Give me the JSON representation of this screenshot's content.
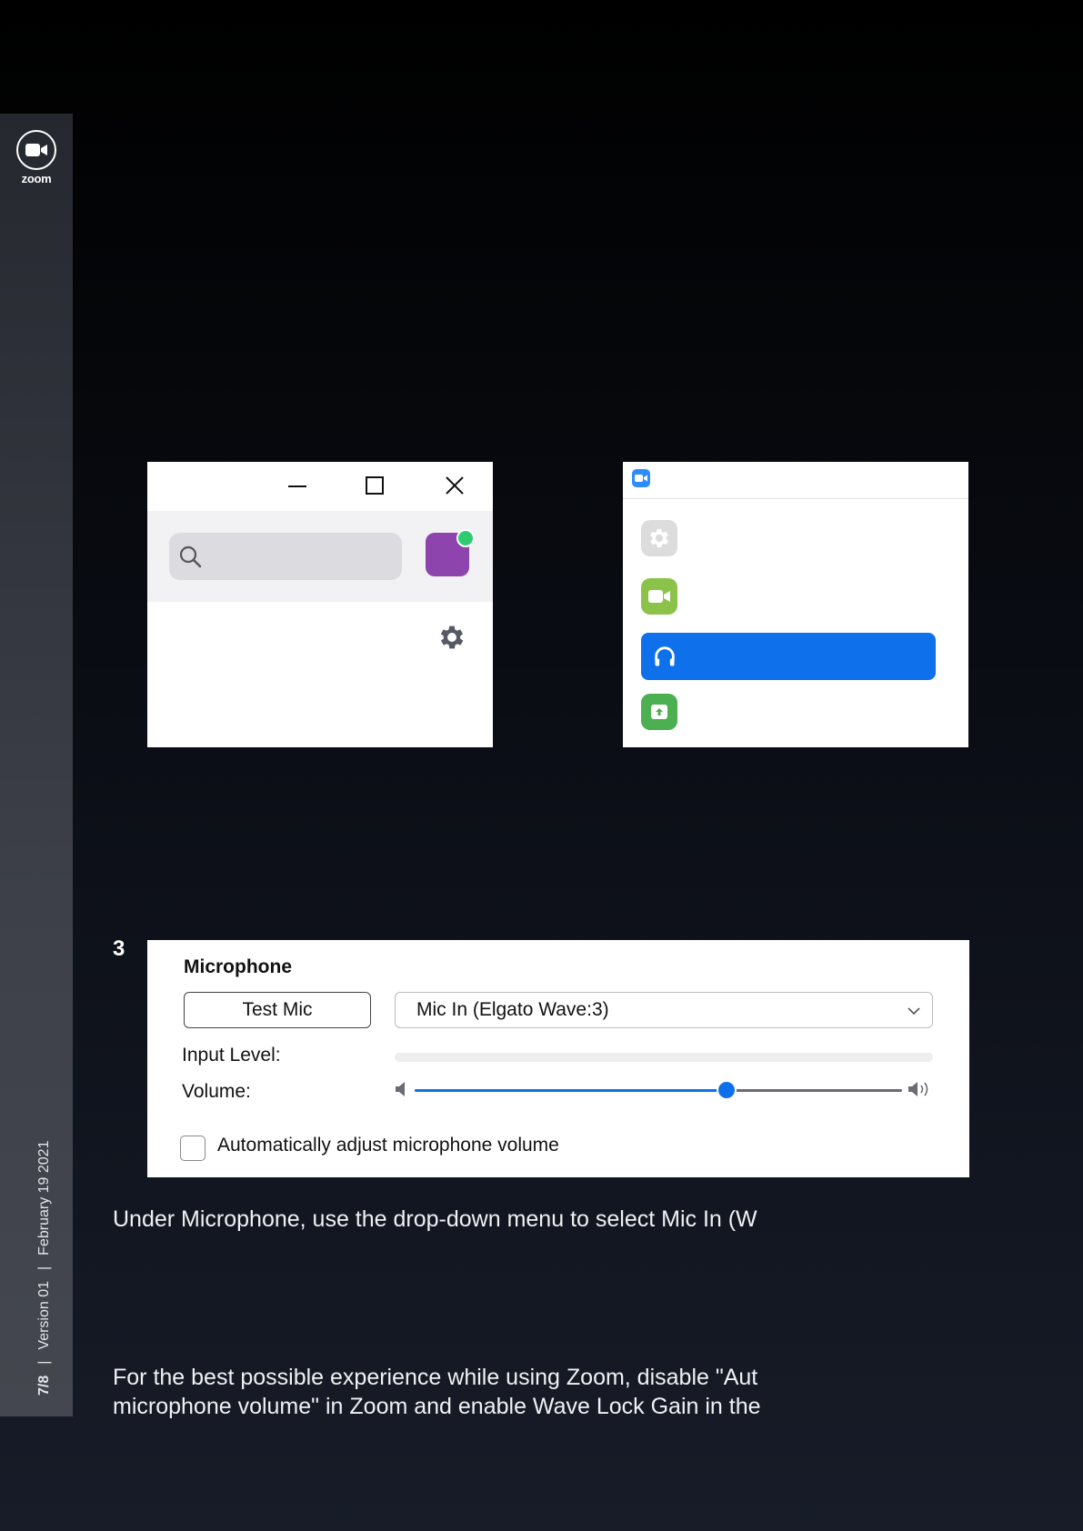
{
  "sidebar": {
    "logo_word": "zoom",
    "page": "7/8",
    "version": "Version 01",
    "date": "February 19 2021"
  },
  "step": {
    "number": "3"
  },
  "microphone": {
    "title": "Microphone",
    "test_button": "Test Mic",
    "selected_device": "Mic In (Elgato Wave:3)",
    "input_level_label": "Input Level:",
    "input_level": 0,
    "volume_label": "Volume:",
    "volume": 0.64,
    "auto_adjust_label": "Automatically adjust microphone volume",
    "auto_adjust_checked": false
  },
  "body_text": {
    "instruction": "Under Microphone, use the drop-down menu to select Mic In (W",
    "tip_line1": "For the best possible experience while using Zoom,  disable \"Aut",
    "tip_line2": "microphone volume\" in Zoom and enable Wave Lock Gain in the"
  },
  "colors": {
    "accent_blue": "#0e71eb",
    "avatar_purple": "#8e44ad",
    "presence_green": "#2ecc71",
    "video_green": "#8bc34a",
    "share_green": "#4caf50"
  },
  "icons": {
    "win1": [
      "minimize-icon",
      "maximize-icon",
      "close-icon",
      "search-icon",
      "gear-icon"
    ],
    "win2": [
      "zoom-app-icon",
      "settings-icon",
      "video-icon",
      "headphones-icon",
      "share-screen-icon"
    ]
  }
}
